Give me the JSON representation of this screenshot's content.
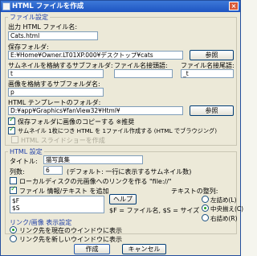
{
  "window": {
    "title": "HTML ファイルを作成",
    "close_label": "×"
  },
  "file_settings": {
    "legend": "ファイル設定",
    "output_name_label": "出力 HTML ファイル名:",
    "output_name_value": "Cats.html",
    "save_folder_label": "保存フォルダ:",
    "save_folder_value": "E:¥Home¥Owner.LT01XP.000¥デスクトップ¥cats",
    "browse_label": "参照",
    "thumb_subfolder_label": "サムネイルを格納するサブフォルダ:",
    "thumb_subfolder_value": "t",
    "filename_prefix_label": "ファイル名接頭語:",
    "filename_prefix_value": "",
    "filename_suffix_label": "ファイル名接尾語:",
    "filename_suffix_value": "_t",
    "image_subfolder_label": "画像を格納するサブフォルダ名:",
    "image_subfolder_value": "p",
    "template_folder_label": "HTML テンプレートのフォルダ:",
    "template_folder_value": "D:¥app¥Graphics¥fanView32¥Html¥",
    "template_browse_label": "参照",
    "copy_images_label": "保存フォルダに画像のコピーする ※推奨",
    "one_thumb_label": "サムネイル 1枚につき HTML を 1ファイル作成する (HTML でブラウジング)",
    "slideshow_label": "HTML スライドショーを作成"
  },
  "html_settings": {
    "legend": "HTML 設定",
    "title_label": "タイトル:",
    "title_value": "猫写真集",
    "columns_label": "列数:",
    "columns_value": "6",
    "columns_hint": "(デフォルト: 一行に表示するサムネイル数)",
    "local_original_label": "ローカルディスクの元画像へのリンクを作る \"file://\"",
    "file_info_label": "ファイル 情報/テキスト を追加",
    "file_info_text": "$F\n$S",
    "help_label": "ヘルプ",
    "help_hint": "$F = ファイル名, $S = サイズ",
    "align_label": "テキストの整列:",
    "align_options": [
      "左詰め(L)",
      "中央揃え(C)",
      "右詰め(R)"
    ]
  },
  "link_settings": {
    "legend": "リンク/画像 表示設定",
    "options": [
      "リンク先を現在のウインドウに表示",
      "リンク先を新しいウインドウに表示"
    ]
  },
  "footer": {
    "create_label": "作成",
    "cancel_label": "キャンセル"
  }
}
